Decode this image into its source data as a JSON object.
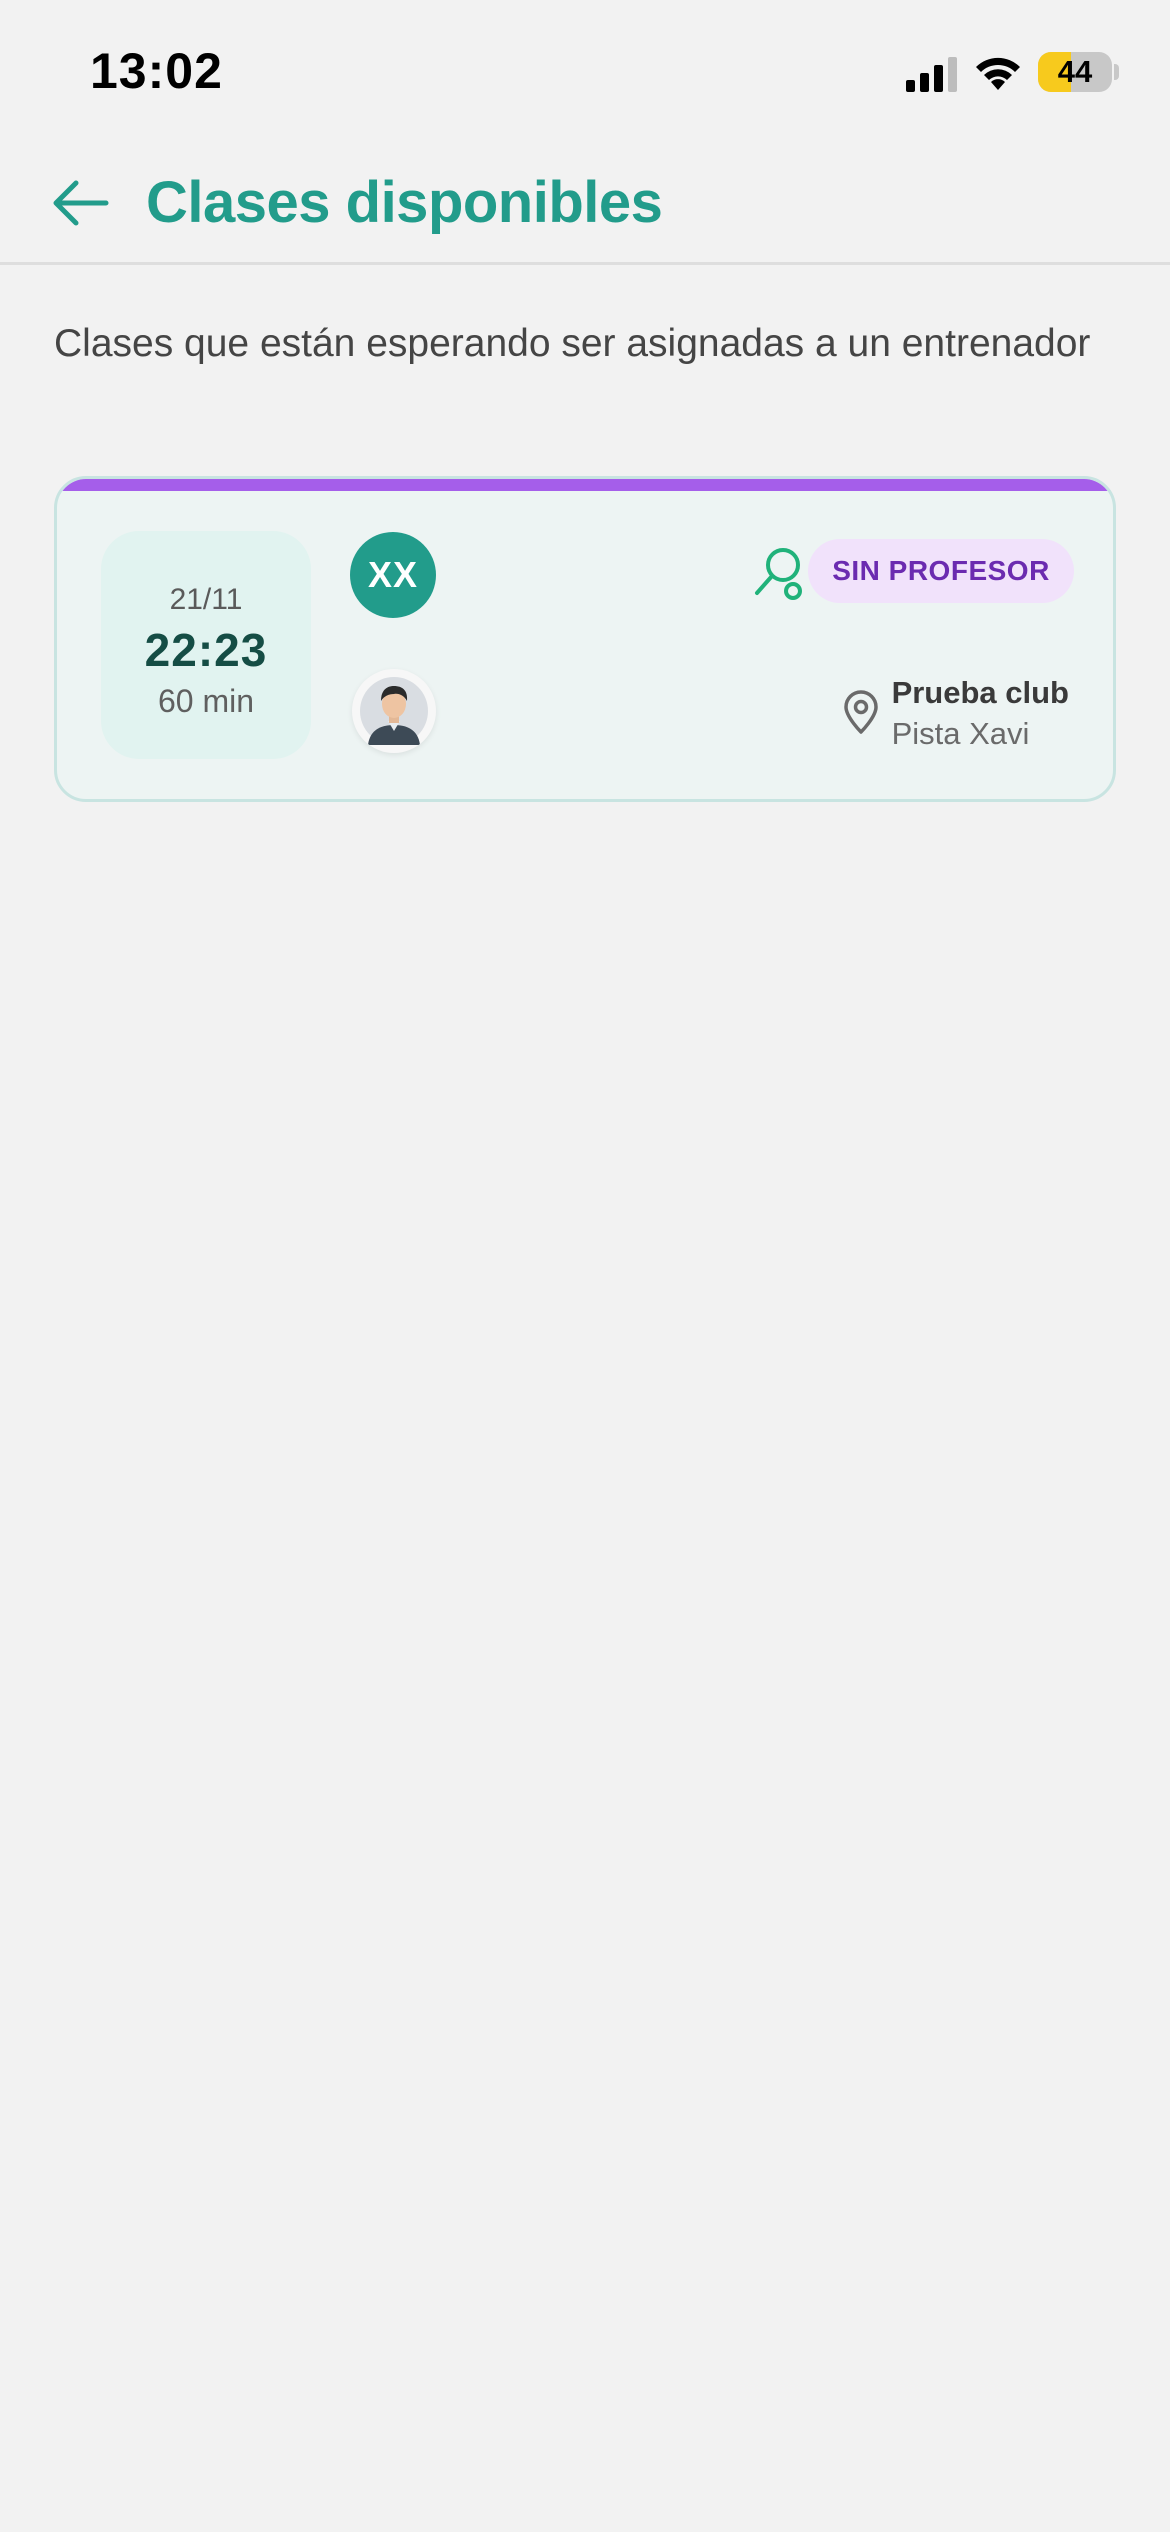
{
  "status_bar": {
    "time": "13:02",
    "battery": "44"
  },
  "header": {
    "title": "Clases disponibles",
    "back_icon": "arrow-left-icon"
  },
  "subtitle": "Clases que están esperando ser asignadas a un entrenador",
  "classes": [
    {
      "date": "21/11",
      "time": "22:23",
      "duration": "60 min",
      "initials": "XX",
      "status": "SIN PROFESOR",
      "club": "Prueba club",
      "court": "Pista Xavi"
    }
  ],
  "colors": {
    "primary": "#229c8b",
    "accent": "#a55eea",
    "badge_bg": "#f1e2fb",
    "badge_text": "#6b2bb0",
    "background": "#f2f2f2"
  }
}
